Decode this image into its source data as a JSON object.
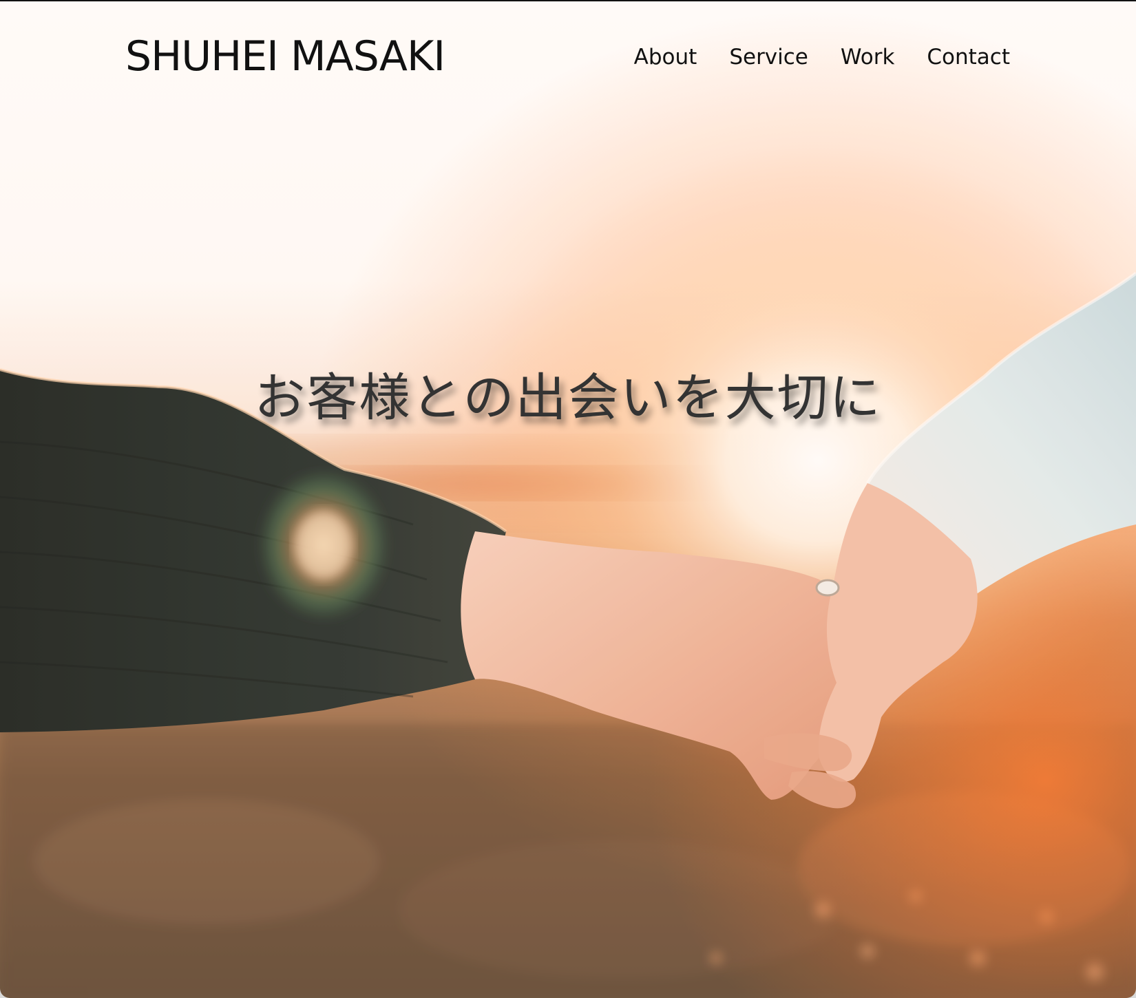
{
  "site": {
    "logo": "SHUHEI MASAKI"
  },
  "nav": {
    "items": [
      {
        "label": "About"
      },
      {
        "label": "Service"
      },
      {
        "label": "Work"
      },
      {
        "label": "Contact"
      }
    ]
  },
  "hero": {
    "tagline": "お客様との出会いを大切に",
    "image_icon": "holding-hands-sunset-photo",
    "colors": {
      "sky": "#ffffff",
      "glow": "#ff8a3d",
      "sleeve_dark": "#27302c",
      "sleeve_light": "#dce8ea",
      "skin": "#f2b9a2",
      "field": "#7a5a40"
    }
  },
  "colors": {
    "text": "#111111",
    "tagline_text": "#333333"
  }
}
